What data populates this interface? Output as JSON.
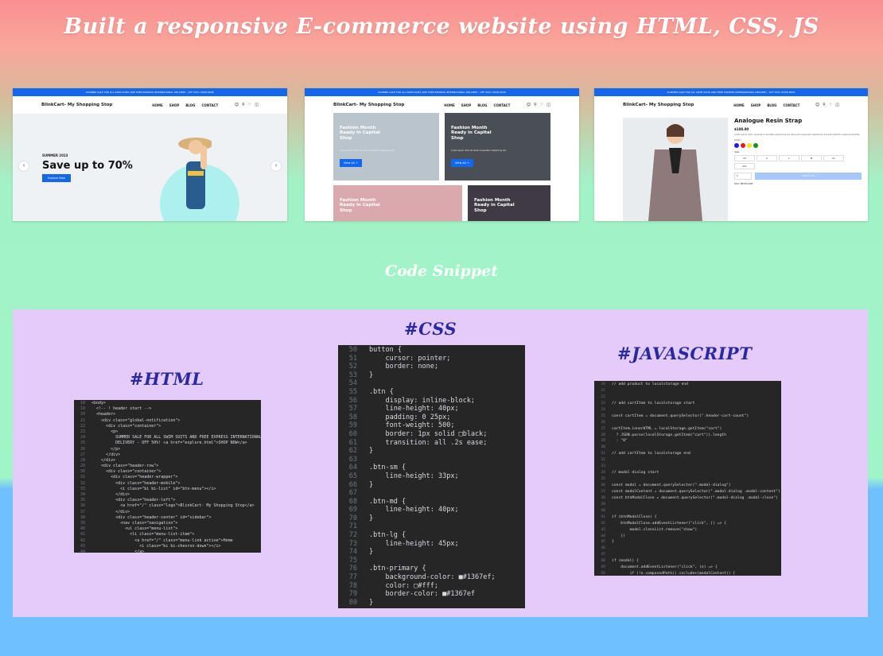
{
  "page": {
    "title": "Built a responsive E-commerce website using HTML, CSS, JS",
    "subtitle": "Code Snippet"
  },
  "colors": {
    "accent": "#1367ef",
    "label": "#2a2aa0",
    "panel": "#e5cbf9",
    "code_bg": "#262626"
  },
  "site": {
    "announcement": "SUMMER SALE FOR ALL SWIM SUITS AND FREE EXPRESS INTERNATIONAL DELIVERY - OFF 50%! SHOP NOW",
    "logo": "BlinkCart- My Shopping Stop",
    "nav": [
      "HOME",
      "SHOP",
      "BLOG",
      "CONTACT"
    ],
    "icons": [
      "user-icon",
      "search-icon",
      "heart-icon",
      "cart-icon"
    ]
  },
  "home": {
    "season": "SUMMER 2023",
    "heading": "Save up to 70%",
    "button": "Explore Now"
  },
  "shop": {
    "tiles": [
      {
        "title": "Fashion Month Ready in Capital Shop",
        "desc": "Lorem ipsum dolor sit amet consectetur adipisicing elit.",
        "button": "View All →",
        "bg": "#b9c4cc"
      },
      {
        "title": "Fashion Month Ready in Capital Shop",
        "desc": "Lorem ipsum dolor sit amet consectetur adipisicing elit.",
        "button": "View All →",
        "bg": "#4a4e55"
      },
      {
        "title": "Fashion Month Ready in Capital Shop",
        "bg": "#d9a9ae"
      },
      {
        "title": "Fashion Month Ready in Capital Shop",
        "bg": "#3f3a44"
      }
    ]
  },
  "product": {
    "name": "Analogue Resin Strap",
    "price": "$108.00",
    "description": "Lorem ipsum dolor, sit amet consectetur adipisicing elit. Iste animi quisquam repellendus impedit distinctio eligendi blanditiis.",
    "color_label": "Color",
    "swatches": [
      "#1a1ae6",
      "#e61a1a",
      "#f2e61a",
      "#1a8c1a"
    ],
    "size_label": "Size",
    "sizes": [
      "XS",
      "S",
      "L",
      "M",
      "XL",
      "XXL"
    ],
    "qty": "1",
    "add_to_cart": "Add to cart",
    "sku": "SKU: BE45VGRT"
  },
  "snippets": {
    "html_label": "#HTML",
    "css_label": "#CSS",
    "js_label": "#JAVASCRIPT",
    "html": [
      {
        "n": "18",
        "t": "<body>"
      },
      {
        "n": "19",
        "t": "  <!-- ! header start -->"
      },
      {
        "n": "20",
        "t": "  <header>"
      },
      {
        "n": "21",
        "t": "    <div class=\"global-notification\">"
      },
      {
        "n": "22",
        "t": "      <div class=\"container\">"
      },
      {
        "n": "23",
        "t": "        <p>"
      },
      {
        "n": "24",
        "t": "          SUMMER SALE FOR ALL SWIM SUITS AND FREE EXPRESS INTERNATIONAL"
      },
      {
        "n": "25",
        "t": "          DELIVERY - OFF 50%! <a href=\"explore.html\">SHOP NOW</a>"
      },
      {
        "n": "26",
        "t": "        </p>"
      },
      {
        "n": "27",
        "t": "      </div>"
      },
      {
        "n": "28",
        "t": "    </div>"
      },
      {
        "n": "29",
        "t": "    <div class=\"header-row\">"
      },
      {
        "n": "30",
        "t": "      <div class=\"container\">"
      },
      {
        "n": "31",
        "t": "        <div class=\"header-wrapper\">"
      },
      {
        "n": "32",
        "t": "          <div class=\"header-mobile\">"
      },
      {
        "n": "33",
        "t": "            <i class=\"bi bi-list\" id=\"btn-menu\"></i>"
      },
      {
        "n": "34",
        "t": "          </div>"
      },
      {
        "n": "35",
        "t": "          <div class=\"header-left\">"
      },
      {
        "n": "36",
        "t": "            <a href=\"/\" class=\"logo\">BlinkCart- My Shopping Stop</a>"
      },
      {
        "n": "37",
        "t": "          </div>"
      },
      {
        "n": "38",
        "t": "          <div class=\"header-center\" id=\"sidebar\">"
      },
      {
        "n": "39",
        "t": "            <nav class=\"navigation\">"
      },
      {
        "n": "40",
        "t": "              <ul class=\"menu-list\">"
      },
      {
        "n": "41",
        "t": "                <li class=\"menu-list-item\">"
      },
      {
        "n": "42",
        "t": "                  <a href=\"/\" class=\"menu-link active\">Home"
      },
      {
        "n": "43",
        "t": "                    <i class=\"bi bi-chevron-down\"></i>"
      },
      {
        "n": "44",
        "t": "                  </a>"
      }
    ],
    "css": [
      {
        "n": "50",
        "t": "button {"
      },
      {
        "n": "51",
        "t": "    cursor: pointer;"
      },
      {
        "n": "52",
        "t": "    border: none;"
      },
      {
        "n": "53",
        "t": "}"
      },
      {
        "n": "54",
        "t": ""
      },
      {
        "n": "55",
        "t": ".btn {"
      },
      {
        "n": "56",
        "t": "    display: inline-block;"
      },
      {
        "n": "57",
        "t": "    line-height: 40px;"
      },
      {
        "n": "58",
        "t": "    padding: 0 25px;"
      },
      {
        "n": "59",
        "t": "    font-weight: 500;"
      },
      {
        "n": "60",
        "t": "    border: 1px solid □black;"
      },
      {
        "n": "61",
        "t": "    transition: all .2s ease;"
      },
      {
        "n": "62",
        "t": "}"
      },
      {
        "n": "63",
        "t": ""
      },
      {
        "n": "64",
        "t": ".btn-sm {"
      },
      {
        "n": "65",
        "t": "    line-height: 33px;"
      },
      {
        "n": "66",
        "t": "}"
      },
      {
        "n": "67",
        "t": ""
      },
      {
        "n": "68",
        "t": ".btn-md {"
      },
      {
        "n": "69",
        "t": "    line-height: 40px;"
      },
      {
        "n": "70",
        "t": "}"
      },
      {
        "n": "71",
        "t": ""
      },
      {
        "n": "72",
        "t": ".btn-lg {"
      },
      {
        "n": "73",
        "t": "    line-height: 45px;"
      },
      {
        "n": "74",
        "t": "}"
      },
      {
        "n": "75",
        "t": ""
      },
      {
        "n": "76",
        "t": ".btn-primary {"
      },
      {
        "n": "77",
        "t": "    background-color: ■#1367ef;"
      },
      {
        "n": "78",
        "t": "    color: □#fff;"
      },
      {
        "n": "79",
        "t": "    border-color: ■#1367ef"
      },
      {
        "n": "80",
        "t": "}"
      }
    ],
    "js": [
      {
        "n": "20",
        "t": "// add product to localstorage end"
      },
      {
        "n": "21",
        "t": ""
      },
      {
        "n": "22",
        "t": ""
      },
      {
        "n": "23",
        "t": "// add cartItem to localstorage start"
      },
      {
        "n": "24",
        "t": ""
      },
      {
        "n": "25",
        "t": "const cartItem = document.querySelector(\".header-cart-count\")"
      },
      {
        "n": "26",
        "t": ""
      },
      {
        "n": "27",
        "t": "cartItem.innerHTML = localStorage.getItem(\"cart\")"
      },
      {
        "n": "28",
        "t": "  ? JSON.parse(localStorage.getItem(\"cart\")).length"
      },
      {
        "n": "29",
        "t": "  : \"0\""
      },
      {
        "n": "30",
        "t": ""
      },
      {
        "n": "31",
        "t": "// add cartItem to localstorage end"
      },
      {
        "n": "32",
        "t": ""
      },
      {
        "n": "33",
        "t": ""
      },
      {
        "n": "34",
        "t": "// modal dialog start"
      },
      {
        "n": "35",
        "t": ""
      },
      {
        "n": "36",
        "t": "const modal = document.querySelector(\".modal-dialog\")"
      },
      {
        "n": "37",
        "t": "const modalContent = document.querySelector(\".modal-dialog .modal-content\")"
      },
      {
        "n": "38",
        "t": "const btnModalClose = document.querySelector(\".modal-dialog .modal-close\")"
      },
      {
        "n": "39",
        "t": ""
      },
      {
        "n": "40",
        "t": ""
      },
      {
        "n": "41",
        "t": "if (btnModalClose) {"
      },
      {
        "n": "42",
        "t": "    btnModalClose.addEventListener(\"click\", () => {"
      },
      {
        "n": "43",
        "t": "        modal.classList.remove(\"show\")"
      },
      {
        "n": "44",
        "t": "    })"
      },
      {
        "n": "45",
        "t": "}"
      },
      {
        "n": "46",
        "t": ""
      },
      {
        "n": "47",
        "t": ""
      },
      {
        "n": "48",
        "t": "if (modal) {"
      },
      {
        "n": "49",
        "t": "    document.addEventListener(\"click\", (e) => {"
      },
      {
        "n": "50",
        "t": "        if (!e.composedPath().includes(modalContent)) {"
      },
      {
        "n": "51",
        "t": "            modal.classList.remove(\"show\")"
      },
      {
        "n": "52",
        "t": "        }"
      },
      {
        "n": "53",
        "t": "    })"
      },
      {
        "n": "54",
        "t": "}"
      },
      {
        "n": "55",
        "t": "}"
      }
    ]
  }
}
